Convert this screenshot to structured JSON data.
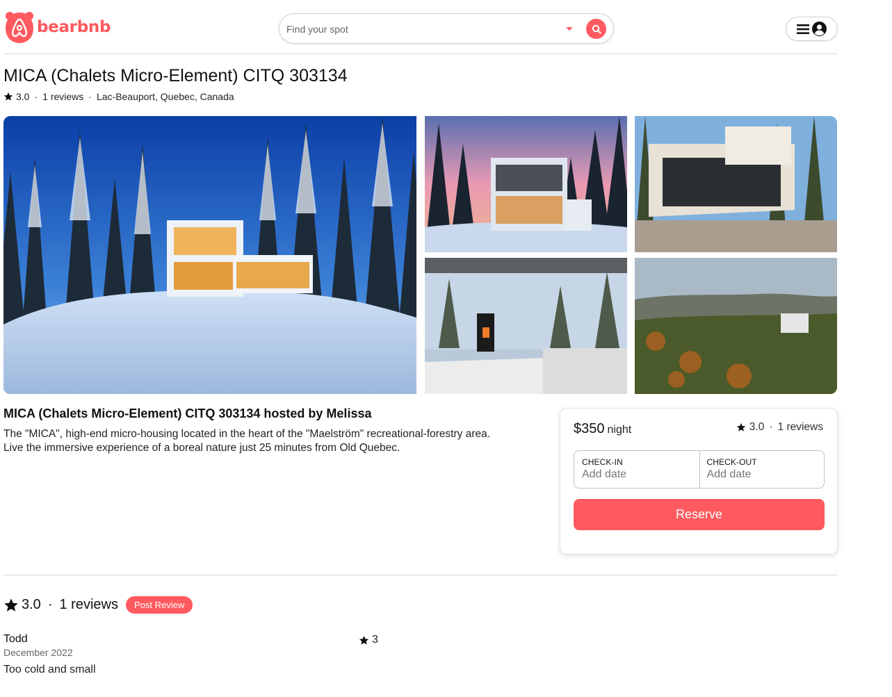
{
  "header": {
    "logo_text": "bearbnb",
    "search_placeholder": "Find your spot"
  },
  "listing": {
    "title": "MICA (Chalets Micro-Element) CITQ 303134",
    "rating": "3.0",
    "reviews_label": "1 reviews",
    "location": "Lac-Beauport, Quebec, Canada",
    "host_heading": "MICA (Chalets Micro-Element) CITQ 303134 hosted by Melissa",
    "description_lines": [
      "The \"MICA\", high-end micro-housing located in the heart of the \"Maelström\" recreational-forestry area.",
      "Live the immersive experience of a boreal nature just 25 minutes from Old Quebec."
    ]
  },
  "booking": {
    "price": "$350",
    "price_unit": "night",
    "rating": "3.0",
    "reviews_label": "1 reviews",
    "checkin_label": "CHECK-IN",
    "checkin_value": "Add date",
    "checkout_label": "CHECK-OUT",
    "checkout_value": "Add date",
    "reserve_label": "Reserve"
  },
  "reviews_section": {
    "rating": "3.0",
    "count_label": "1 reviews",
    "post_review_label": "Post Review",
    "reviews": [
      {
        "author": "Todd",
        "date": "December 2022",
        "stars": "3",
        "text": "Too cold and small"
      }
    ]
  },
  "separator_dot": "·",
  "colors": {
    "brand": "#ff5a5f",
    "border": "#d9d9d9"
  },
  "icons": [
    "bear-logo-icon",
    "caret-down-icon",
    "search-icon",
    "menu-icon",
    "user-icon",
    "star-icon"
  ]
}
